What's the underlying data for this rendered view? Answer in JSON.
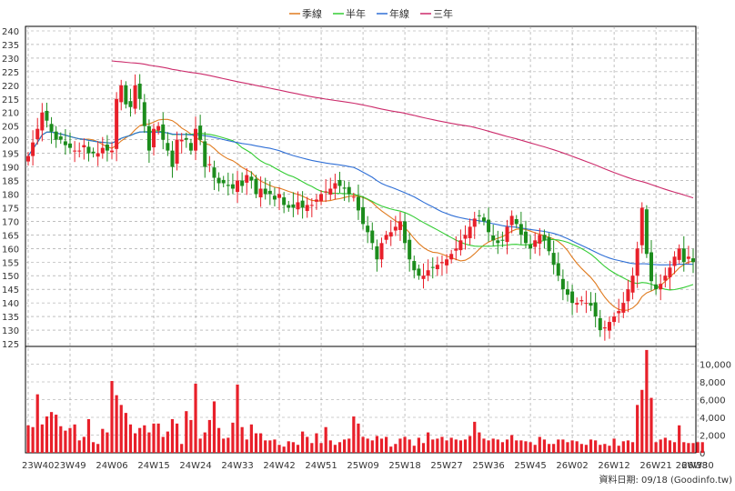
{
  "chart_data": {
    "type": "candlestick",
    "legend": [
      {
        "name": "季線",
        "color": "#e07b1f"
      },
      {
        "name": "半年",
        "color": "#33cc33"
      },
      {
        "name": "年線",
        "color": "#2f6fd6"
      },
      {
        "name": "三年",
        "color": "#cc2b6b"
      }
    ],
    "colors": {
      "up": "#e8202a",
      "down": "#1c8c1c",
      "volume": "#e8202a",
      "grid": "#999999"
    },
    "price_axis": {
      "min": 125,
      "max": 240,
      "ticks": [
        125,
        130,
        135,
        140,
        145,
        150,
        155,
        160,
        165,
        170,
        175,
        180,
        185,
        190,
        195,
        200,
        205,
        210,
        215,
        220,
        225,
        230,
        235,
        240
      ]
    },
    "volume_axis": {
      "min": 0,
      "max": 12000,
      "ticks": [
        0,
        2000,
        4000,
        6000,
        8000,
        10000
      ],
      "tick_labels": [
        "0",
        "2,000",
        "4,000",
        "6,000",
        "8,000",
        "10,000"
      ]
    },
    "x_ticks": [
      {
        "i": 0,
        "label": "23W40"
      },
      {
        "i": 9,
        "label": "23W49"
      },
      {
        "i": 18,
        "label": "24W06"
      },
      {
        "i": 27,
        "label": "24W15"
      },
      {
        "i": 36,
        "label": "24W24"
      },
      {
        "i": 45,
        "label": "24W33"
      },
      {
        "i": 54,
        "label": "24W42"
      },
      {
        "i": 63,
        "label": "24W51"
      },
      {
        "i": 72,
        "label": "25W09"
      },
      {
        "i": 81,
        "label": "25W18"
      },
      {
        "i": 90,
        "label": "25W27"
      },
      {
        "i": 99,
        "label": "25W36"
      },
      {
        "i": 108,
        "label": "25W45"
      },
      {
        "i": 117,
        "label": "26W02"
      },
      {
        "i": 126,
        "label": "26W12"
      },
      {
        "i": 135,
        "label": "26W21"
      },
      {
        "i": 144,
        "label": "26W30"
      },
      {
        "i": 153,
        "label": "26W38"
      }
    ],
    "close": [
      194,
      199,
      204,
      210,
      207,
      203,
      200,
      200,
      198,
      197,
      196,
      196,
      198,
      195,
      195,
      195,
      197,
      196,
      196,
      215,
      220,
      213,
      212,
      220,
      215,
      205,
      196,
      204,
      205,
      200,
      196,
      190,
      200,
      200,
      200,
      196,
      204,
      200,
      190,
      191,
      186,
      184,
      184,
      183,
      182,
      185,
      183,
      187,
      185,
      180,
      182,
      180,
      180,
      178,
      180,
      176,
      175,
      175,
      177,
      175,
      176,
      176,
      178,
      180,
      181,
      182,
      184,
      183,
      182,
      180,
      179,
      174,
      169,
      166,
      162,
      156,
      162,
      165,
      166,
      168,
      170,
      162,
      156,
      152,
      150,
      150,
      152,
      153,
      154,
      155,
      156,
      158,
      160,
      163,
      165,
      168,
      171,
      172,
      170,
      166,
      163,
      162,
      163,
      168,
      172,
      169,
      165,
      162,
      160,
      163,
      165,
      163,
      159,
      154,
      150,
      145,
      143,
      140,
      140,
      141,
      140,
      139,
      135,
      130,
      131,
      133,
      135,
      137,
      140,
      145,
      150,
      160,
      175,
      158,
      148,
      145,
      147,
      150,
      153,
      157,
      160,
      155,
      157,
      155
    ],
    "volume": [
      3100,
      2900,
      6600,
      3200,
      4100,
      4600,
      4300,
      3000,
      2500,
      2800,
      3200,
      1400,
      1800,
      3800,
      1200,
      1000,
      2700,
      2300,
      8100,
      6500,
      5400,
      4500,
      3200,
      2200,
      2800,
      3100,
      2300,
      3300,
      3300,
      1800,
      2400,
      3800,
      3300,
      1000,
      4700,
      3700,
      7800,
      1600,
      2300,
      3700,
      5800,
      2800,
      1600,
      1700,
      3400,
      7700,
      2900,
      1500,
      3200,
      2200,
      2200,
      1400,
      1400,
      1500,
      900,
      700,
      1300,
      1200,
      900,
      2400,
      1800,
      1100,
      2200,
      1100,
      2900,
      1400,
      900,
      1200,
      1500,
      1600,
      4100,
      3300,
      1800,
      1600,
      1400,
      1900,
      1600,
      1800,
      700,
      1000,
      1600,
      1800,
      1500,
      800,
      1700,
      1100,
      2300,
      1500,
      1600,
      1800,
      1400,
      1700,
      1500,
      1400,
      1500,
      1900,
      3500,
      2300,
      1600,
      1400,
      1600,
      1500,
      1200,
      1500,
      2000,
      1400,
      1400,
      1300,
      1200,
      900,
      1800,
      1500,
      1000,
      1000,
      1500,
      1500,
      1200,
      1400,
      1300,
      1000,
      900,
      1500,
      1400,
      900,
      1000,
      800,
      1600,
      800,
      1300,
      1400,
      1200,
      5400,
      7100,
      11600,
      6200,
      1200,
      1500,
      1700,
      1400,
      1200,
      3100,
      1200,
      1100,
      1100,
      1200,
      1200
    ]
  },
  "credit": "資料日期: 09/18 (Goodinfo.tw)"
}
